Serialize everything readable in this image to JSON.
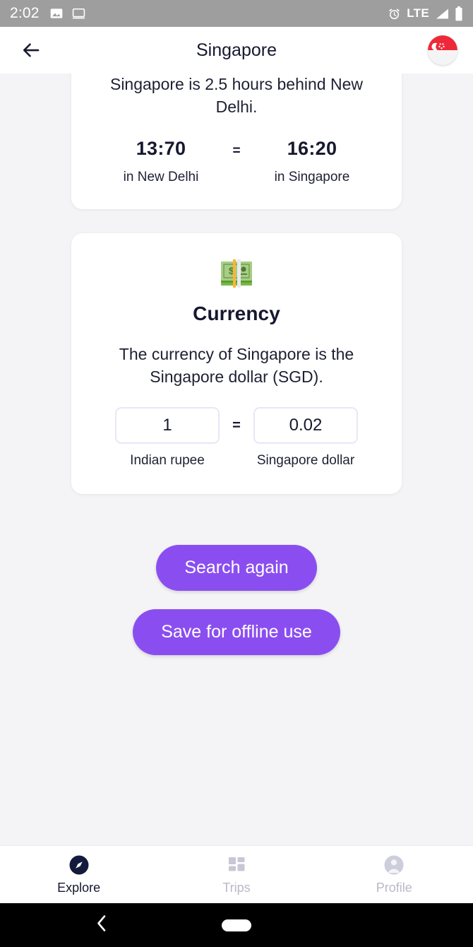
{
  "status_bar": {
    "clock": "2:02",
    "network": "LTE",
    "icons": [
      "image-icon",
      "cast-screen-icon",
      "alarm-icon",
      "signal-icon",
      "battery-icon"
    ],
    "background": "#9e9e9e"
  },
  "app_bar": {
    "title": "Singapore",
    "back_icon": "arrow-left-icon",
    "flag": {
      "name": "singapore-flag",
      "top_color": "#ed2939",
      "bottom_color": "#f4f4f6"
    }
  },
  "time_card": {
    "description": "Singapore is 2.5 hours behind New Delhi.",
    "equals": "=",
    "from": {
      "value": "13:70",
      "label": "in New Delhi"
    },
    "to": {
      "value": "16:20",
      "label": "in Singapore"
    }
  },
  "currency_card": {
    "icon": "banknote-emoji",
    "heading": "Currency",
    "description": "The currency of Singapore is the Singapore dollar (SGD).",
    "equals": "=",
    "from": {
      "value": "1",
      "placeholder": "1",
      "label": "Indian rupee"
    },
    "to": {
      "value": "0.02",
      "placeholder": "0.02",
      "label": "Singapore dollar"
    }
  },
  "actions": {
    "search_again": "Search again",
    "save_offline": "Save for offline use",
    "accent_color": "#8a4ef0"
  },
  "bottom_nav": {
    "items": [
      {
        "label": "Explore",
        "icon": "compass-icon",
        "active": true
      },
      {
        "label": "Trips",
        "icon": "grid-icon",
        "active": false
      },
      {
        "label": "Profile",
        "icon": "person-icon",
        "active": false
      }
    ],
    "active_color": "#16182f",
    "inactive_color": "#b9b9c8"
  },
  "system_nav": {
    "back_icon": "chevron-left-icon",
    "home_icon": "home-pill-icon",
    "background": "#000000"
  }
}
